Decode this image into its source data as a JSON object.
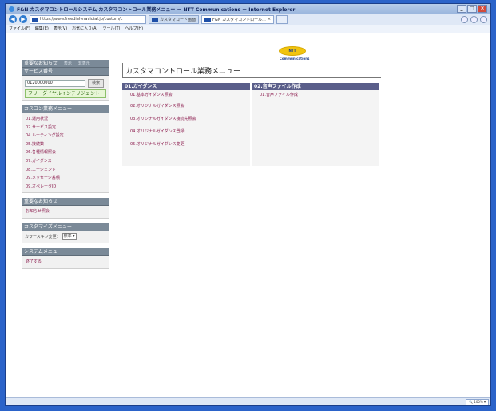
{
  "window": {
    "title": "F&N カスタマコントロールシステム カスタマコントロール業務メニュー － NTT Communications － Internet Explorer"
  },
  "nav": {
    "address": "https://www.freedialvnavidial.jp/custom/c",
    "tabs": [
      {
        "label": "カスタマコード画面"
      },
      {
        "label": "F&N カスタマコントロール..."
      }
    ]
  },
  "menu": [
    "ファイル(F)",
    "編集(E)",
    "表示(V)",
    "お気に入り(A)",
    "ツール(T)",
    "ヘルプ(H)"
  ],
  "logo": {
    "text": "NTT Communications"
  },
  "sidebar": {
    "notice_header": "重要なお知らせ",
    "notice_show": "表示",
    "notice_hide": "非表示",
    "service_header": "サービス番号",
    "service_value": "0120000000",
    "service_button": "検索",
    "service_label": "フリーダイヤルインテリジェント",
    "custom_menu_header": "カスコン業務メニュー",
    "custom_menu": [
      "01.運用状況",
      "02.サービス設定",
      "04.ルーティング設定",
      "05.接続数",
      "06.各種情報照会",
      "07.ガイダンス",
      "08.エージェント",
      "09.メッセージ蓄積",
      "09.オペレータID"
    ],
    "notice2_header": "重要なお知らせ",
    "notice2_link": "お知らせ照会",
    "customize_header": "カスタマイズメニュー",
    "color_skin_label": "カラースキン変更：",
    "color_skin_value": "標準",
    "system_header": "システムメニュー",
    "exit_link": "終了する"
  },
  "main": {
    "title": "カスタマコントロール業務メニュー",
    "col1": {
      "header": "01.ガイダンス",
      "items": [
        "01.基本ガイダンス照会",
        "02.オリジナルガイダンス照会",
        "03.オリジナルガイダンス接続先照会",
        "04.オリジナルガイダンス登録",
        "05.オリジナルガイダンス変更"
      ]
    },
    "col2": {
      "header": "02.音声ファイル作成",
      "items": [
        "01.音声ファイル作成"
      ]
    }
  },
  "status": {
    "zoom": "100%"
  }
}
